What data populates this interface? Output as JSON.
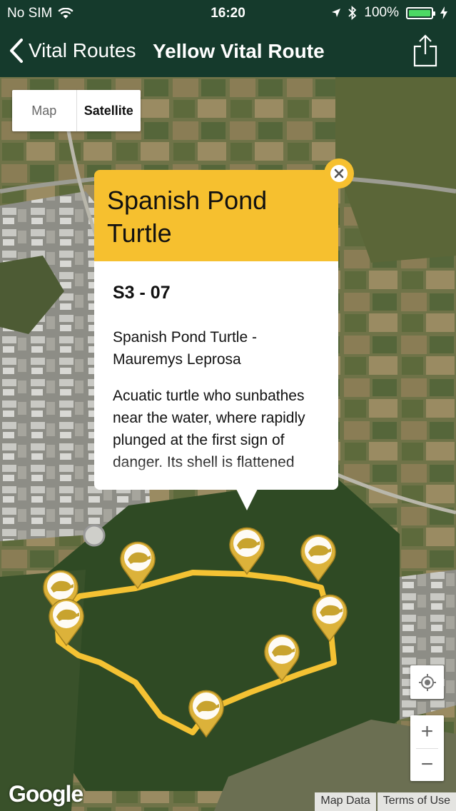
{
  "status_bar": {
    "carrier": "No SIM",
    "time": "16:20",
    "battery": "100%",
    "battery_level": 1.0
  },
  "nav": {
    "back_label": "Vital Routes",
    "title": "Yellow Vital Route"
  },
  "map_type": {
    "map_label": "Map",
    "satellite_label": "Satellite",
    "selected": "Satellite"
  },
  "popup": {
    "title": "Spanish Pond Turtle",
    "code": "S3 - 07",
    "subtitle": "Spanish Pond Turtle - Mauremys Leprosa",
    "description": "Acuatic turtle who sunbathes near the water, where rapidly plunged at the first sign of danger. Its shell is flattened"
  },
  "zoom": {
    "in_label": "+",
    "out_label": "−"
  },
  "attribution": {
    "logo": "Google",
    "map_data": "Map Data",
    "terms": "Terms of Use"
  },
  "colors": {
    "nav_bg": "#153a2c",
    "accent_yellow": "#f6c02f",
    "route_yellow": "#f4c233",
    "battery_green": "#4cd964"
  },
  "icons": {
    "marker": "turtle-marker-icon",
    "back": "chevron-left-icon",
    "share": "share-icon",
    "close": "close-icon",
    "location": "my-location-icon"
  }
}
